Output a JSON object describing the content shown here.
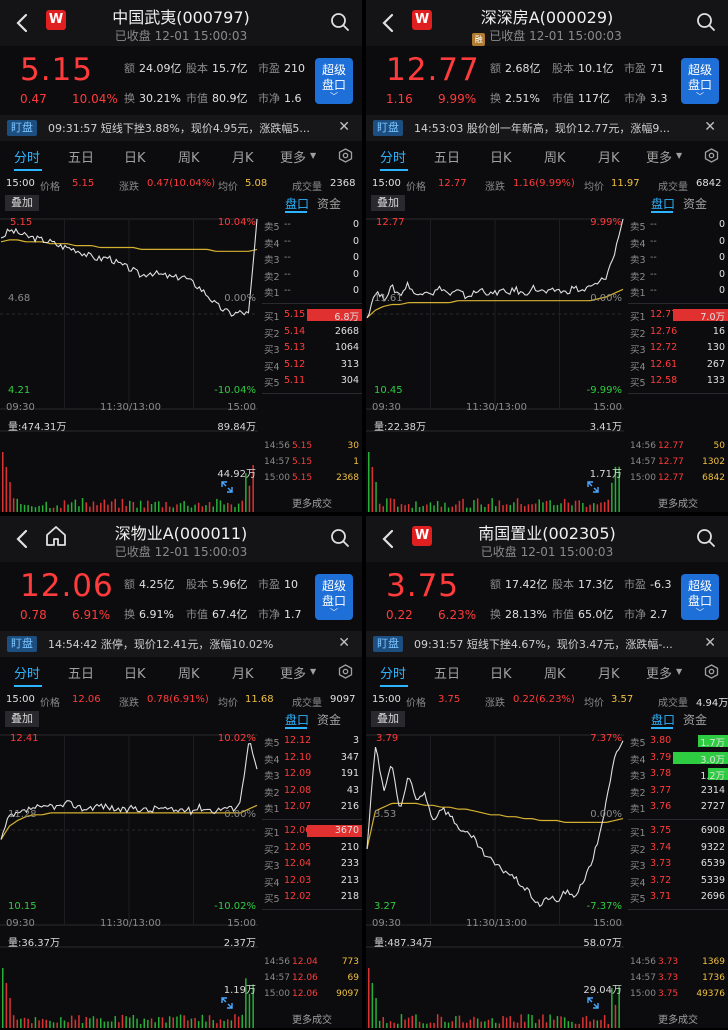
{
  "labels": {
    "tabs": [
      "分时",
      "五日",
      "日K",
      "周K",
      "月K",
      "更多"
    ],
    "alert_tag": "盯盘",
    "diejia": "叠加",
    "ob_tabs": [
      "盘口",
      "资金"
    ],
    "more_trades": "更多成交",
    "super_btn": [
      "超级",
      "盘口"
    ],
    "info_keys": [
      "价格",
      "涨跌",
      "均价",
      "成交量"
    ],
    "kv_keys": [
      "额",
      "股本",
      "市盈",
      "换",
      "市值",
      "市净"
    ],
    "status": "已收盘",
    "rong": "融"
  },
  "colors": {
    "up": "#ff3b3b",
    "down": "#2ecc40",
    "accent": "#2db4ff",
    "avg": "#d4b030",
    "price_line": "#e0e0e0"
  },
  "panels": [
    {
      "title": "中国武夷(000797)",
      "subtitle": "12-01 15:00:03",
      "rong": false,
      "home_icon": false,
      "price": "5.15",
      "change": "0.47",
      "pct": "10.04%",
      "kv": [
        "24.09亿",
        "15.7亿",
        "210",
        "30.21%",
        "80.9亿",
        "1.6"
      ],
      "alert": "09:31:57 短线下挫3.88%，现价4.95元，涨跌幅5...",
      "info": {
        "time": "15:00",
        "price": "5.15",
        "change": "0.47(10.04%)",
        "avg": "5.08",
        "vol": "2368"
      },
      "axis": {
        "top": "4.68",
        "top_label": "5.15",
        "top_pct": "10.04%",
        "mid": "4.68",
        "mid_pct": "0.00%",
        "bot": "4.21",
        "bot_pct": "-10.04%",
        "volmax": "89.84万",
        "volmid": "44.92万",
        "vol": "量:474.31万"
      },
      "x_labels": [
        "09:30",
        "11:30/13:00",
        "15:00"
      ],
      "asks": [
        [
          "卖5",
          "--",
          "0"
        ],
        [
          "卖4",
          "--",
          "0"
        ],
        [
          "卖3",
          "--",
          "0"
        ],
        [
          "卖2",
          "--",
          "0"
        ],
        [
          "卖1",
          "--",
          "0"
        ]
      ],
      "bids": [
        [
          "买1",
          "5.15",
          "6.8万"
        ],
        [
          "买2",
          "5.14",
          "2668"
        ],
        [
          "买3",
          "5.13",
          "1064"
        ],
        [
          "买4",
          "5.12",
          "313"
        ],
        [
          "买5",
          "5.11",
          "304"
        ]
      ],
      "ask_fill": [
        0,
        0,
        0,
        0,
        0
      ],
      "bid_fill": [
        0.55,
        0,
        0,
        0,
        0
      ],
      "ticks": [
        [
          "14:56",
          "5.15",
          "30"
        ],
        [
          "14:57",
          "5.15",
          "1"
        ],
        [
          "15:00",
          "5.15",
          "2368"
        ]
      ],
      "chart": {
        "open": 0.88,
        "prices": [
          0.9,
          0.94,
          0.93,
          0.91,
          0.9,
          0.89,
          0.88,
          0.86,
          0.85,
          0.84,
          0.82,
          0.8,
          0.79,
          0.8,
          0.77,
          0.75,
          0.73,
          0.7,
          0.72,
          0.71,
          0.7,
          0.69,
          0.7,
          0.67,
          0.64,
          0.6,
          0.55,
          0.52,
          0.5,
          0.51,
          0.5,
          1.0
        ],
        "avg": [
          0.88,
          0.89,
          0.89,
          0.88,
          0.88,
          0.88,
          0.87,
          0.87,
          0.87,
          0.86,
          0.86,
          0.86,
          0.85,
          0.85,
          0.85,
          0.85,
          0.85,
          0.84,
          0.84,
          0.84,
          0.84,
          0.84,
          0.84,
          0.84,
          0.84,
          0.84,
          0.83,
          0.83,
          0.83,
          0.83,
          0.83,
          0.84
        ]
      }
    },
    {
      "title": "深深房A(000029)",
      "subtitle": "12-01 15:00:03",
      "rong": true,
      "home_icon": false,
      "price": "12.77",
      "change": "1.16",
      "pct": "9.99%",
      "kv": [
        "2.68亿",
        "10.1亿",
        "71",
        "2.51%",
        "117亿",
        "3.3"
      ],
      "alert": "14:53:03 股价创一年新高，现价12.77元，涨幅9...",
      "info": {
        "time": "15:00",
        "price": "12.77",
        "change": "1.16(9.99%)",
        "avg": "11.97",
        "vol": "6842"
      },
      "axis": {
        "top": "12.77",
        "top_label": "12.77",
        "top_pct": "9.99%",
        "mid": "11.61",
        "mid_pct": "0.00%",
        "bot": "10.45",
        "bot_pct": "-9.99%",
        "volmax": "3.41万",
        "volmid": "1.71万",
        "vol": "量:22.38万"
      },
      "x_labels": [
        "09:30",
        "11:30/13:00",
        "15:00"
      ],
      "asks": [
        [
          "卖5",
          "--",
          "0"
        ],
        [
          "卖4",
          "--",
          "0"
        ],
        [
          "卖3",
          "--",
          "0"
        ],
        [
          "卖2",
          "--",
          "0"
        ],
        [
          "卖1",
          "--",
          "0"
        ]
      ],
      "bids": [
        [
          "买1",
          "12.77",
          "7.0万"
        ],
        [
          "买2",
          "12.76",
          "16"
        ],
        [
          "买3",
          "12.72",
          "130"
        ],
        [
          "买4",
          "12.61",
          "267"
        ],
        [
          "买5",
          "12.58",
          "133"
        ]
      ],
      "ask_fill": [
        0,
        0,
        0,
        0,
        0
      ],
      "bid_fill": [
        0.55,
        0,
        0,
        0,
        0
      ],
      "ticks": [
        [
          "14:56",
          "12.77",
          "50"
        ],
        [
          "14:57",
          "12.77",
          "1302"
        ],
        [
          "15:00",
          "12.77",
          "6842"
        ]
      ],
      "chart": {
        "open": 0.5,
        "prices": [
          0.48,
          0.62,
          0.58,
          0.64,
          0.6,
          0.66,
          0.59,
          0.63,
          0.61,
          0.64,
          0.6,
          0.62,
          0.59,
          0.61,
          0.63,
          0.6,
          0.62,
          0.61,
          0.63,
          0.6,
          0.64,
          0.62,
          0.61,
          0.63,
          0.61,
          0.64,
          0.62,
          0.64,
          0.66,
          0.7,
          0.82,
          1.0
        ],
        "avg": [
          0.48,
          0.52,
          0.54,
          0.55,
          0.55,
          0.56,
          0.56,
          0.56,
          0.56,
          0.56,
          0.56,
          0.57,
          0.57,
          0.57,
          0.57,
          0.57,
          0.57,
          0.57,
          0.57,
          0.57,
          0.57,
          0.57,
          0.57,
          0.57,
          0.57,
          0.57,
          0.57,
          0.57,
          0.58,
          0.59,
          0.61,
          0.63
        ]
      }
    },
    {
      "title": "深物业A(000011)",
      "subtitle": "12-01 15:00:03",
      "rong": false,
      "home_icon": true,
      "price": "12.06",
      "change": "0.78",
      "pct": "6.91%",
      "kv": [
        "4.25亿",
        "5.96亿",
        "10",
        "6.91%",
        "67.4亿",
        "1.7"
      ],
      "alert": "14:54:42 涨停，现价12.41元，涨幅10.02%",
      "info": {
        "time": "15:00",
        "price": "12.06",
        "change": "0.78(6.91%)",
        "avg": "11.68",
        "vol": "9097"
      },
      "axis": {
        "top": "12.41",
        "top_label": "12.41",
        "top_pct": "10.02%",
        "mid": "11.28",
        "mid_pct": "0.00%",
        "bot": "10.15",
        "bot_pct": "-10.02%",
        "volmax": "2.37万",
        "volmid": "1.19万",
        "vol": "量:36.37万"
      },
      "x_labels": [
        "09:30",
        "11:30/13:00",
        "15:00"
      ],
      "asks": [
        [
          "卖5",
          "12.12",
          "3"
        ],
        [
          "卖4",
          "12.10",
          "347"
        ],
        [
          "卖3",
          "12.09",
          "191"
        ],
        [
          "卖2",
          "12.08",
          "43"
        ],
        [
          "卖1",
          "12.07",
          "216"
        ]
      ],
      "bids": [
        [
          "买1",
          "12.06",
          "3670"
        ],
        [
          "买2",
          "12.05",
          "210"
        ],
        [
          "买3",
          "12.04",
          "233"
        ],
        [
          "买4",
          "12.03",
          "213"
        ],
        [
          "买5",
          "12.02",
          "218"
        ]
      ],
      "ask_fill": [
        0,
        0,
        0,
        0,
        0
      ],
      "bid_fill": [
        0.55,
        0,
        0,
        0,
        0
      ],
      "ticks": [
        [
          "14:56",
          "12.04",
          "773"
        ],
        [
          "14:57",
          "12.06",
          "69"
        ],
        [
          "15:00",
          "12.06",
          "9097"
        ]
      ],
      "chart": {
        "open": 0.5,
        "prices": [
          0.45,
          0.57,
          0.58,
          0.6,
          0.62,
          0.61,
          0.63,
          0.62,
          0.64,
          0.63,
          0.61,
          0.62,
          0.63,
          0.62,
          0.61,
          0.6,
          0.62,
          0.61,
          0.6,
          0.62,
          0.61,
          0.6,
          0.61,
          0.6,
          0.62,
          0.61,
          0.6,
          0.62,
          0.61,
          0.65,
          0.98,
          0.82
        ],
        "avg": [
          0.45,
          0.52,
          0.55,
          0.57,
          0.58,
          0.58,
          0.59,
          0.59,
          0.59,
          0.59,
          0.59,
          0.59,
          0.59,
          0.59,
          0.59,
          0.59,
          0.59,
          0.59,
          0.59,
          0.59,
          0.59,
          0.59,
          0.59,
          0.59,
          0.59,
          0.59,
          0.59,
          0.59,
          0.59,
          0.59,
          0.61,
          0.63
        ]
      }
    },
    {
      "title": "南国置业(002305)",
      "subtitle": "12-01 15:00:03",
      "rong": false,
      "home_icon": false,
      "price": "3.75",
      "change": "0.22",
      "pct": "6.23%",
      "kv": [
        "17.42亿",
        "17.3亿",
        "-6.3",
        "28.13%",
        "65.0亿",
        "2.7"
      ],
      "alert": "09:31:57 短线下挫4.67%，现价3.47元，涨跌幅-...",
      "info": {
        "time": "15:00",
        "price": "3.75",
        "change": "0.22(6.23%)",
        "avg": "3.57",
        "vol": "4.94万"
      },
      "axis": {
        "top": "3.79",
        "top_label": "3.79",
        "top_pct": "7.37%",
        "mid": "3.53",
        "mid_pct": "0.00%",
        "bot": "3.27",
        "bot_pct": "-7.37%",
        "volmax": "58.07万",
        "volmid": "29.04万",
        "vol": "量:487.34万"
      },
      "x_labels": [
        "09:30",
        "11:30/13:00",
        "15:00"
      ],
      "asks": [
        [
          "卖5",
          "3.80",
          "1.7万"
        ],
        [
          "卖4",
          "3.79",
          "3.0万"
        ],
        [
          "卖3",
          "3.78",
          "1.2万"
        ],
        [
          "卖2",
          "3.77",
          "2314"
        ],
        [
          "卖1",
          "3.76",
          "2727"
        ]
      ],
      "bids": [
        [
          "买1",
          "3.75",
          "6908"
        ],
        [
          "买2",
          "3.74",
          "9322"
        ],
        [
          "买3",
          "3.73",
          "6539"
        ],
        [
          "买4",
          "3.72",
          "5339"
        ],
        [
          "买5",
          "3.71",
          "2696"
        ]
      ],
      "ask_fill": [
        0.3,
        0.55,
        0.2,
        0,
        0
      ],
      "bid_fill": [
        0,
        0,
        0,
        0,
        0
      ],
      "ticks": [
        [
          "14:56",
          "3.73",
          "1369"
        ],
        [
          "14:57",
          "3.73",
          "1736"
        ],
        [
          "15:00",
          "3.75",
          "49376"
        ]
      ],
      "chart": {
        "open": 0.5,
        "prices": [
          0.4,
          0.95,
          0.7,
          0.85,
          0.6,
          0.78,
          0.65,
          0.7,
          0.55,
          0.62,
          0.58,
          0.52,
          0.48,
          0.45,
          0.38,
          0.34,
          0.3,
          0.28,
          0.24,
          0.2,
          0.15,
          0.1,
          0.15,
          0.12,
          0.18,
          0.14,
          0.22,
          0.3,
          0.45,
          0.65,
          0.88,
          0.97
        ],
        "avg": [
          0.4,
          0.6,
          0.62,
          0.64,
          0.64,
          0.64,
          0.64,
          0.63,
          0.63,
          0.62,
          0.62,
          0.61,
          0.61,
          0.6,
          0.59,
          0.58,
          0.58,
          0.57,
          0.57,
          0.56,
          0.56,
          0.55,
          0.55,
          0.55,
          0.54,
          0.54,
          0.54,
          0.54,
          0.54,
          0.54,
          0.55,
          0.56
        ]
      }
    }
  ]
}
